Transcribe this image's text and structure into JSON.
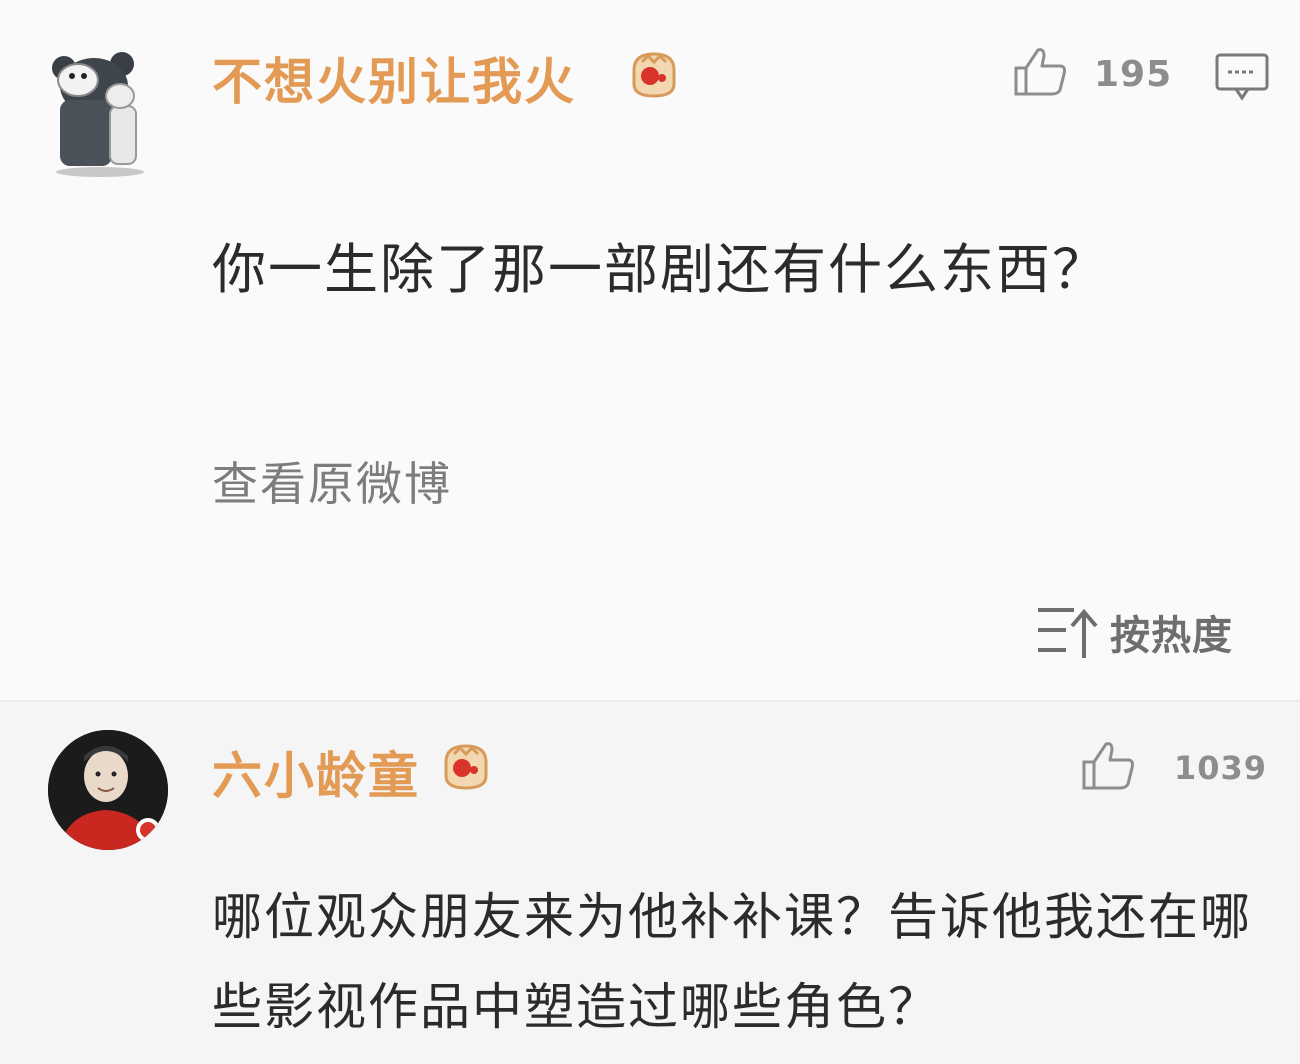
{
  "comments": [
    {
      "username": "不想火别让我火",
      "likes": "195",
      "text": "你一生除了那一部剧还有什么东西？",
      "view_original": "查看原微博",
      "avatar_icon": "bear-avatar-icon",
      "badge_icon": "fan-badge-icon"
    },
    {
      "username": "六小龄童",
      "likes": "1039",
      "text": "哪位观众朋友来为他补补课？告诉他我还在哪些影视作品中塑造过哪些角色？",
      "avatar_icon": "person-avatar-icon",
      "badge_icon": "fan-badge-icon"
    }
  ],
  "sort": {
    "label": "按热度",
    "icon": "sort-up-icon"
  },
  "colors": {
    "username": "#e39a54",
    "muted": "#8d8d8d",
    "badge_red": "#d9342b"
  }
}
